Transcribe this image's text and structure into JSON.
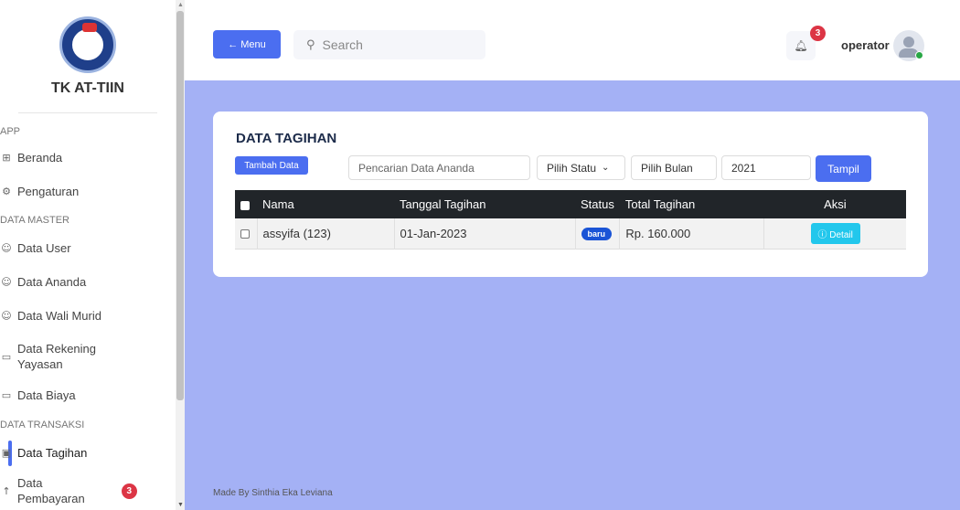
{
  "brand": {
    "name": "TK AT-TIIN"
  },
  "sidebar": {
    "sections": {
      "app": "APP",
      "master": "DATA MASTER",
      "transaksi": "DATA TRANSAKSI"
    },
    "items": [
      {
        "label": "Beranda",
        "icon": "grid-icon"
      },
      {
        "label": "Pengaturan",
        "icon": "gear-icon"
      },
      {
        "label": "Data User",
        "icon": "users-icon"
      },
      {
        "label": "Data Ananda",
        "icon": "users-icon"
      },
      {
        "label": "Data Wali Murid",
        "icon": "users-icon"
      },
      {
        "label": "Data Rekening",
        "label2": "Yayasan",
        "icon": "card-icon"
      },
      {
        "label": "Data Biaya",
        "icon": "card-icon"
      },
      {
        "label": "Data Tagihan",
        "icon": "calendar-icon",
        "active": true
      },
      {
        "label": "Data",
        "label2": "Pembayaran",
        "icon": "payment-icon",
        "badge": "3"
      }
    ]
  },
  "topbar": {
    "menu_label": "← Menu",
    "search_placeholder": "Search",
    "notif_count": "3",
    "user": "operator"
  },
  "main": {
    "title": "DATA TAGIHAN",
    "add_button": "Tambah Data",
    "filters": {
      "search_placeholder": "Pencarian Data Ananda",
      "status": "Pilih Statu",
      "month": "Pilih Bulan",
      "year": "2021",
      "submit": "Tampil"
    },
    "table": {
      "headers": {
        "nama": "Nama",
        "tanggal": "Tanggal Tagihan",
        "status": "Status",
        "total": "Total Tagihan",
        "aksi": "Aksi"
      },
      "rows": [
        {
          "nama": "assyifa (123)",
          "tanggal": "01-Jan-2023",
          "status": "baru",
          "total": "Rp. 160.000",
          "aksi": "ⓘ Detail"
        }
      ]
    },
    "footer": "Made By Sinthia Eka Leviana"
  },
  "colors": {
    "accent": "#4b6ef0",
    "main_bg": "#a4b1f5",
    "table_head": "#212529",
    "status": "#1a54d6",
    "detail": "#22c7ec",
    "badge": "#dc3545"
  }
}
